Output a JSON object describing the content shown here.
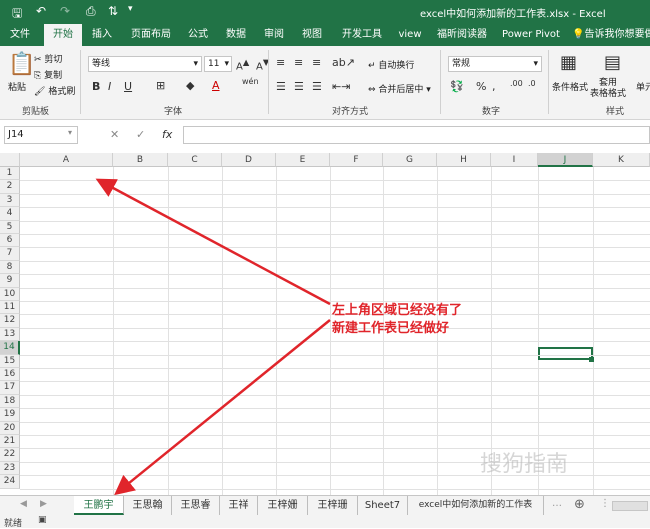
{
  "title_bar": {
    "filename": "excel中如何添加新的工作表.xlsx  -  Excel"
  },
  "tabs": [
    "文件",
    "开始",
    "插入",
    "页面布局",
    "公式",
    "数据",
    "审阅",
    "视图",
    "开发工具",
    "view",
    "福昕阅读器",
    "Power Pivot"
  ],
  "tell_me": "告诉我你想要做",
  "ribbon": {
    "paste": "粘贴",
    "cut": "剪切",
    "copy": "复制",
    "format_painter": "格式刷",
    "clipboard_group": "剪贴板",
    "font_name": "等线",
    "font_size": "11",
    "font_group": "字体",
    "wrap_text": "自动换行",
    "merge_center": "合并后居中",
    "alignment_group": "对齐方式",
    "number_format": "常规",
    "number_group": "数字",
    "conditional_format": "条件格式",
    "table_format": "套用\n表格格式",
    "cell_styles": "单元",
    "styles_group": "样式"
  },
  "formula_bar": {
    "name_box": "J14",
    "formula": ""
  },
  "columns": [
    "A",
    "B",
    "C",
    "D",
    "E",
    "F",
    "G",
    "H",
    "I",
    "J",
    "K"
  ],
  "rows": [
    "1",
    "2",
    "3",
    "4",
    "5",
    "6",
    "7",
    "8",
    "9",
    "10",
    "11",
    "12",
    "13",
    "14",
    "15",
    "16",
    "17",
    "18",
    "19",
    "20",
    "21",
    "22",
    "23",
    "24"
  ],
  "selected_cell": "J14",
  "sheet_tabs": [
    "王鹏宇",
    "王思翰",
    "王思睿",
    "王祥",
    "王梓姗",
    "王梓珊",
    "Sheet7",
    "excel中如何添加新的工作表"
  ],
  "active_sheet": "王鹏宇",
  "status": "就绪",
  "annotation": {
    "line1": "左上角区域已经没有了",
    "line2": "新建工作表已经做好"
  },
  "watermark": "搜狗指南",
  "accent_color": "#217346",
  "annotation_color": "#e0252b"
}
